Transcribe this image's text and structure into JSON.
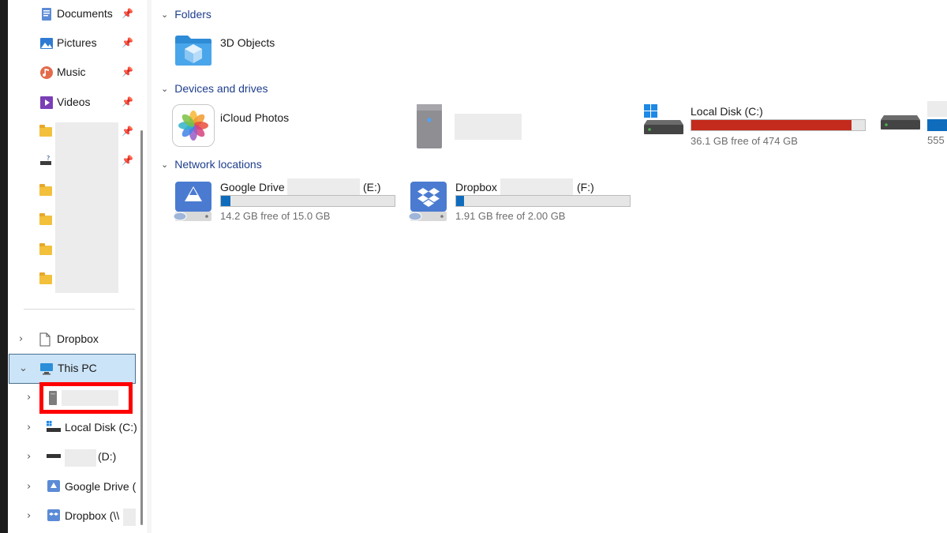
{
  "nav": {
    "quick_access": [
      {
        "label": "Documents",
        "icon": "documents-icon"
      },
      {
        "label": "Pictures",
        "icon": "pictures-icon"
      },
      {
        "label": "Music",
        "icon": "music-icon"
      },
      {
        "label": "Videos",
        "icon": "videos-icon"
      }
    ],
    "tree": {
      "dropbox": "Dropbox",
      "this_pc": "This PC",
      "local_disk": "Local Disk (C:)",
      "d_drive": "(D:)",
      "google_drive": "Google Drive (",
      "dropbox_net": "Dropbox (\\\\"
    }
  },
  "main": {
    "folders_header": "Folders",
    "devices_header": "Devices and drives",
    "network_header": "Network locations",
    "folders": [
      {
        "label": "3D Objects"
      }
    ],
    "devices": [
      {
        "label": "iCloud Photos"
      },
      {
        "label": "Local Disk (C:)",
        "free": "36.1 GB free of 474 GB",
        "used_fraction": 0.924,
        "bar_color": "#c42b1c"
      },
      {
        "partial_free": "555"
      }
    ],
    "network": [
      {
        "label": "Google Drive",
        "letter": "(E:)",
        "free": "14.2 GB free of 15.0 GB",
        "used_fraction": 0.053,
        "bar_color": "#0f6cbd"
      },
      {
        "label": "Dropbox",
        "letter": "(F:)",
        "free": "1.91 GB free of 2.00 GB",
        "used_fraction": 0.045,
        "bar_color": "#0f6cbd"
      }
    ]
  }
}
